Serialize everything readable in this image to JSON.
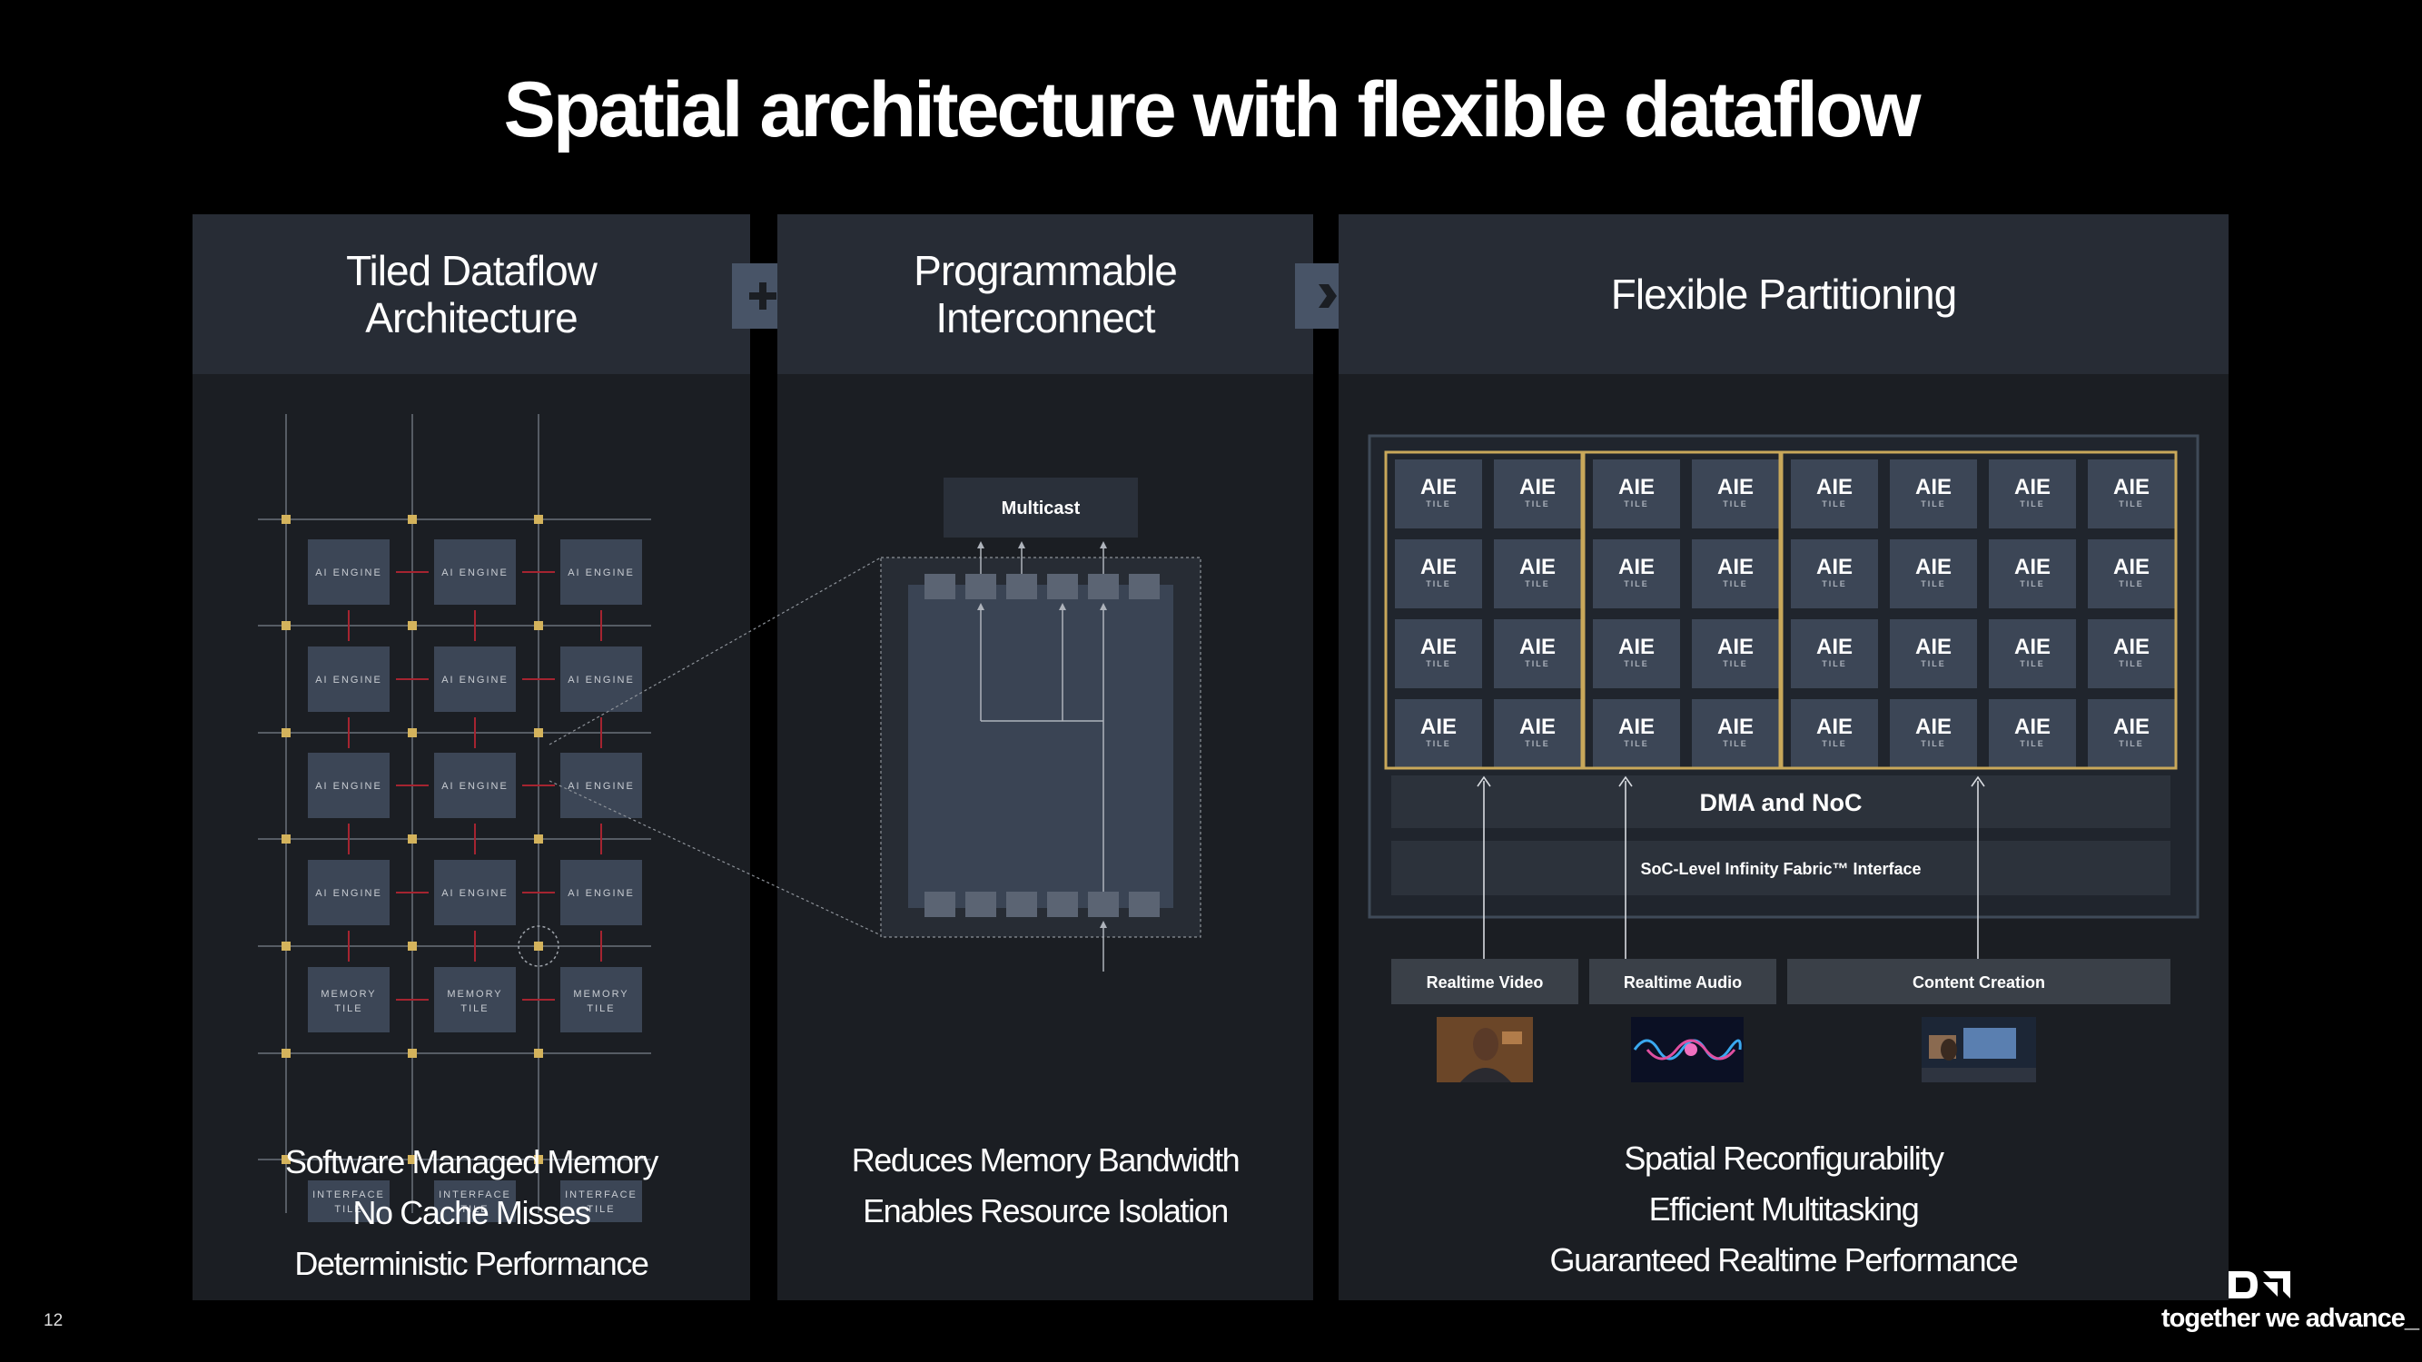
{
  "slide": {
    "title": "Spatial architecture with flexible dataflow",
    "page_number": "12",
    "tagline": "together we advance_",
    "brand_logo": "amd-logo"
  },
  "panels": [
    {
      "title_lines": [
        "Tiled Dataflow",
        "Architecture"
      ],
      "bullets": [
        "Software Managed Memory",
        "No Cache Misses",
        "Deterministic Performance"
      ],
      "diagram": {
        "ai_engine_label": "AI ENGINE",
        "memory_tile_label": [
          "MEMORY",
          "TILE"
        ],
        "interface_tile_label": [
          "INTERFACE",
          "TILE"
        ]
      }
    },
    {
      "title_lines": [
        "Programmable",
        "Interconnect"
      ],
      "bullets": [
        "Reduces Memory Bandwidth",
        "Enables Resource Isolation"
      ],
      "diagram": {
        "multicast_label": "Multicast"
      }
    },
    {
      "title_lines": [
        "Flexible Partitioning"
      ],
      "bullets": [
        "Spatial Reconfigurability",
        "Efficient Multitasking",
        "Guaranteed Realtime Performance"
      ],
      "diagram": {
        "tile_title": "AIE",
        "tile_sub": "TILE",
        "dma_label": "DMA and NoC",
        "fabric_label": "SoC-Level Infinity Fabric™ Interface",
        "workloads": [
          "Realtime Video",
          "Realtime Audio",
          "Content Creation"
        ]
      }
    }
  ],
  "connectors": [
    "plus-icon",
    "chevron-right-icon"
  ],
  "colors": {
    "background": "#000000",
    "panel": "#1b1e23",
    "panel_header": "#272c35",
    "tile": "#3c4656",
    "partition_border": "#c9a85a",
    "arrow_red": "#a52430"
  }
}
